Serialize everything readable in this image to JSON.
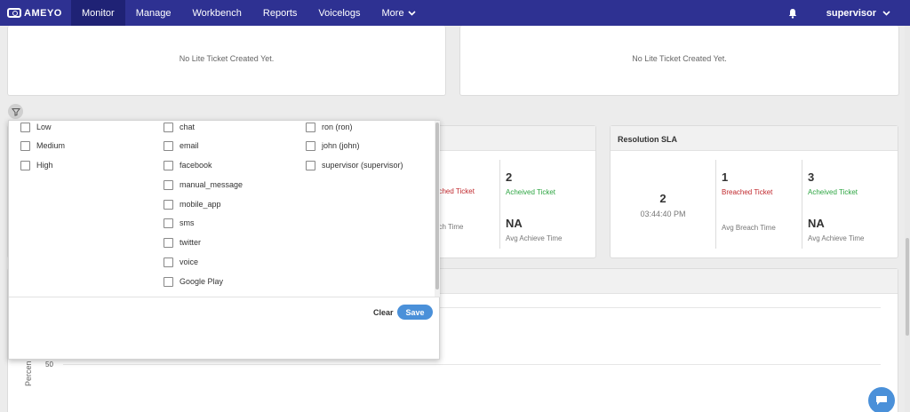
{
  "nav": {
    "logo_text": "AMEYO",
    "items": [
      {
        "label": "Monitor"
      },
      {
        "label": "Manage"
      },
      {
        "label": "Workbench"
      },
      {
        "label": "Reports"
      },
      {
        "label": "Voicelogs"
      },
      {
        "label": "More"
      }
    ],
    "user": "supervisor"
  },
  "lite_tickets": {
    "left_msg": "No Lite Ticket Created Yet.",
    "right_msg": "No Lite Ticket Created Yet."
  },
  "left_sla": {
    "breached_label_fragment": "ached Ticket",
    "breach_time_fragment": "ach Time",
    "achieved_value": "2",
    "achieved_label": "Acheived Ticket",
    "avg_achieve_value": "NA",
    "avg_achieve_label": "Avg Achieve Time"
  },
  "resolution_sla": {
    "title": "Resolution SLA",
    "total_value": "2",
    "total_time": "03:44:40 PM",
    "breached_value": "1",
    "breached_label": "Breached Ticket",
    "avg_breach_label": "Avg Breach Time",
    "achieved_value": "3",
    "achieved_label": "Acheived Ticket",
    "avg_achieve_value": "NA",
    "avg_achieve_label": "Avg Achieve Time"
  },
  "chart_panel": {
    "y_label_fragment": "Percen",
    "tick": "50"
  },
  "filter": {
    "priority": [
      "Low",
      "Medium",
      "High"
    ],
    "channels": [
      "chat",
      "email",
      "facebook",
      "manual_message",
      "mobile_app",
      "sms",
      "twitter",
      "voice",
      "Google Play"
    ],
    "users": [
      "ron (ron)",
      "john (john)",
      "supervisor (supervisor)"
    ],
    "clear_label": "Clear",
    "save_label": "Save"
  },
  "colors": {
    "nav_bg": "#2e3192",
    "accent": "#4a90d9",
    "breached": "#c0282d",
    "achieved": "#2da542"
  }
}
